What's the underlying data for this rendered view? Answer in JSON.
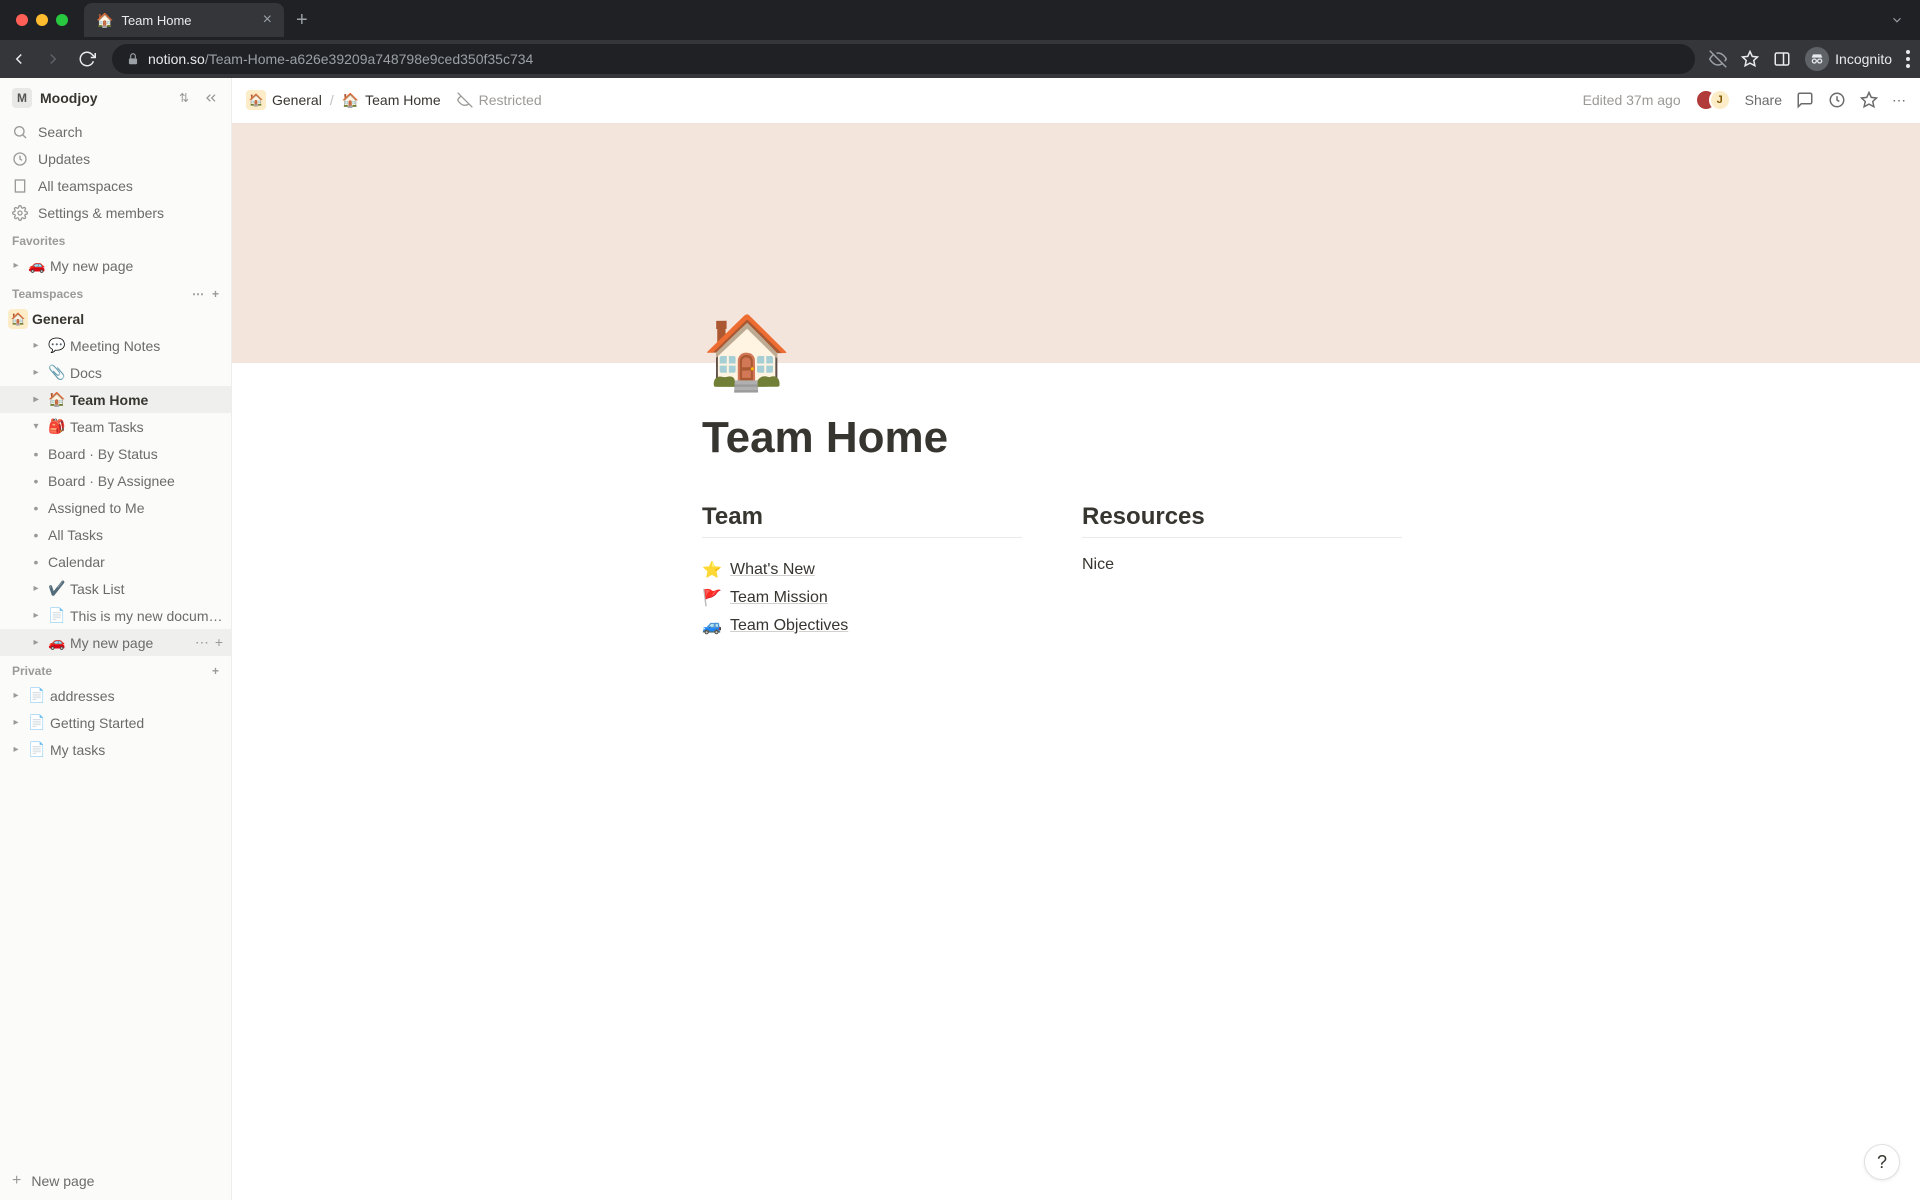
{
  "browser": {
    "tab_icon": "🏠",
    "tab_title": "Team Home",
    "url_host": "notion.so",
    "url_path": "/Team-Home-a626e39209a748798e9ced350f35c734",
    "incognito_label": "Incognito"
  },
  "workspace": {
    "initial": "M",
    "name": "Moodjoy"
  },
  "sidebar_nav": {
    "search": "Search",
    "updates": "Updates",
    "all_teamspaces": "All teamspaces",
    "settings": "Settings & members"
  },
  "sections": {
    "favorites": "Favorites",
    "teamspaces": "Teamspaces",
    "private": "Private"
  },
  "favorites": [
    {
      "icon": "🚗",
      "label": "My new page"
    }
  ],
  "teamspace": {
    "icon": "🏠",
    "label": "General",
    "pages": [
      {
        "icon": "💬",
        "label": "Meeting Notes"
      },
      {
        "icon": "📎",
        "label": "Docs"
      },
      {
        "icon": "🏠",
        "label": "Team Home",
        "active": true
      },
      {
        "icon": "🎒",
        "label": "Team Tasks",
        "expanded": true,
        "children": [
          {
            "label": "Board · By Status"
          },
          {
            "label": "Board · By Assignee"
          },
          {
            "label": "Assigned to Me"
          },
          {
            "label": "All Tasks"
          },
          {
            "label": "Calendar"
          }
        ]
      },
      {
        "icon": "✔️",
        "label": "Task List"
      },
      {
        "icon": "📄",
        "label": "This is my new document"
      },
      {
        "icon": "🚗",
        "label": "My new page",
        "hovered": true
      }
    ]
  },
  "private_pages": [
    {
      "icon": "📄",
      "label": "addresses"
    },
    {
      "icon": "📄",
      "label": "Getting Started"
    },
    {
      "icon": "📄",
      "label": "My tasks"
    }
  ],
  "sidebar_footer": {
    "new_page": "New page"
  },
  "topbar": {
    "breadcrumb": [
      {
        "icon": "🏠",
        "label": "General"
      },
      {
        "icon": "🏠",
        "label": "Team Home"
      }
    ],
    "restricted": "Restricted",
    "edited": "Edited 37m ago",
    "share": "Share",
    "avatar2_initial": "J"
  },
  "page": {
    "icon": "🏠",
    "title": "Team Home",
    "columns": {
      "team": {
        "heading": "Team",
        "links": [
          {
            "emoji": "⭐",
            "text": "What's New"
          },
          {
            "emoji": "🚩",
            "text": "Team Mission"
          },
          {
            "emoji": "🚙",
            "text": "Team Objectives"
          }
        ]
      },
      "resources": {
        "heading": "Resources",
        "text": "Nice"
      }
    }
  },
  "help": "?"
}
